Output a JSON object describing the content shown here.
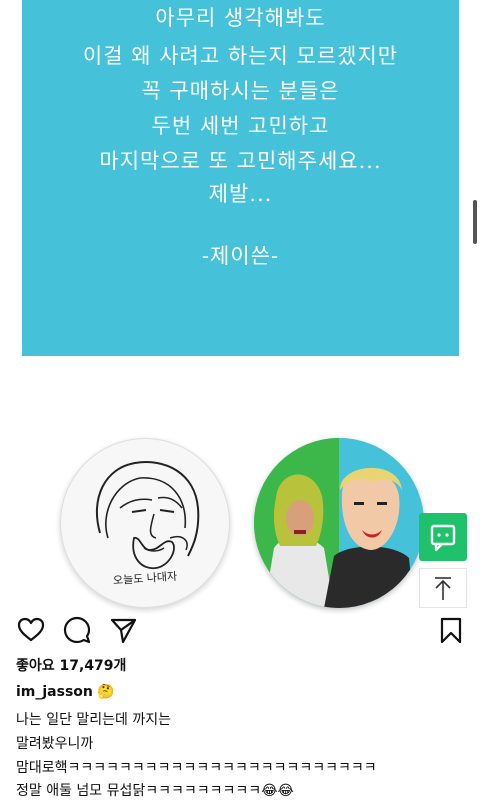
{
  "post_image": {
    "lines": [
      "아무리 생각해봐도",
      "이걸 왜 사려고 하는지 모르겠지만",
      "꼭 구매하시는 분들은",
      "두번 세번 고민하고",
      "마지막으로 또 고민해주세요...",
      "제발...",
      "-제이쓴-"
    ],
    "badge_left_caption": "오늘도 나대자",
    "card_color": "#45c1d9"
  },
  "actions": {
    "like_icon": "heart-icon",
    "comment_icon": "comment-icon",
    "share_icon": "send-icon",
    "save_icon": "bookmark-icon"
  },
  "likes": {
    "text": "좋아요 17,479개"
  },
  "caption": {
    "username": "im_jasson",
    "username_emoji": "🤔",
    "lines": [
      "나는 일단 말리는데 까지는",
      "말려봤우니까",
      "맘대로핵ㅋㅋㅋㅋㅋㅋㅋㅋㅋㅋㅋㅋㅋㅋㅋㅋㅋㅋㅋㅋㅋㅋㅋㅋ",
      "정말 애둘 넘모 뮤섭닭ㅋㅋㅋㅋㅋㅋㅋㅋㅋ😂😂"
    ]
  },
  "floating": {
    "chat_icon": "chat-icon",
    "scroll_top_icon": "arrow-up-icon",
    "chat_color": "#1fc26b"
  }
}
